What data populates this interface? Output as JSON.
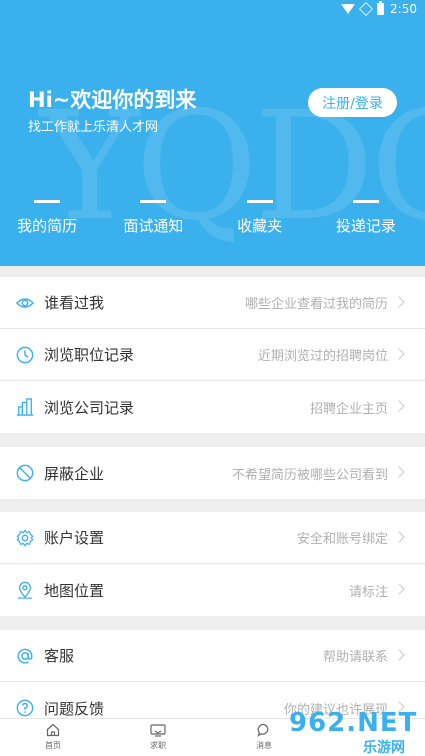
{
  "status_bar": {
    "time": "2:50"
  },
  "header": {
    "watermark": "YQDC",
    "greeting": "Hi~欢迎你的到来",
    "subtitle": "找工作就上乐清人才网",
    "login_button": "注册/登录",
    "shortcuts": [
      {
        "label": "我的简历"
      },
      {
        "label": "面试通知"
      },
      {
        "label": "收藏夹"
      },
      {
        "label": "投递记录"
      }
    ]
  },
  "groups": [
    [
      {
        "title": "谁看过我",
        "hint": "哪些企业查看过我的简历",
        "icon": "eye-icon"
      },
      {
        "title": "浏览职位记录",
        "hint": "近期浏览过的招聘岗位",
        "icon": "clock-icon"
      },
      {
        "title": "浏览公司记录",
        "hint": "招聘企业主页",
        "icon": "building-icon"
      }
    ],
    [
      {
        "title": "屏蔽企业",
        "hint": "不希望简历被哪些公司看到",
        "icon": "block-icon"
      }
    ],
    [
      {
        "title": "账户设置",
        "hint": "安全和账号绑定",
        "icon": "gear-icon"
      },
      {
        "title": "地图位置",
        "hint": "请标注",
        "icon": "location-icon"
      }
    ],
    [
      {
        "title": "客服",
        "hint": "帮助请联系",
        "icon": "at-icon"
      },
      {
        "title": "问题反馈",
        "hint": "你的建议也许展现",
        "icon": "question-icon"
      }
    ]
  ],
  "tabbar": [
    {
      "label": "首页",
      "icon": "home-icon"
    },
    {
      "label": "求职",
      "icon": "briefcase-icon"
    },
    {
      "label": "消息",
      "icon": "chat-icon"
    }
  ],
  "site_watermark": {
    "big": "962.NET",
    "small": "乐游网"
  },
  "colors": {
    "brand": "#3ab0ec",
    "icon": "#3ab0ec",
    "hint": "#b0b0b0"
  }
}
